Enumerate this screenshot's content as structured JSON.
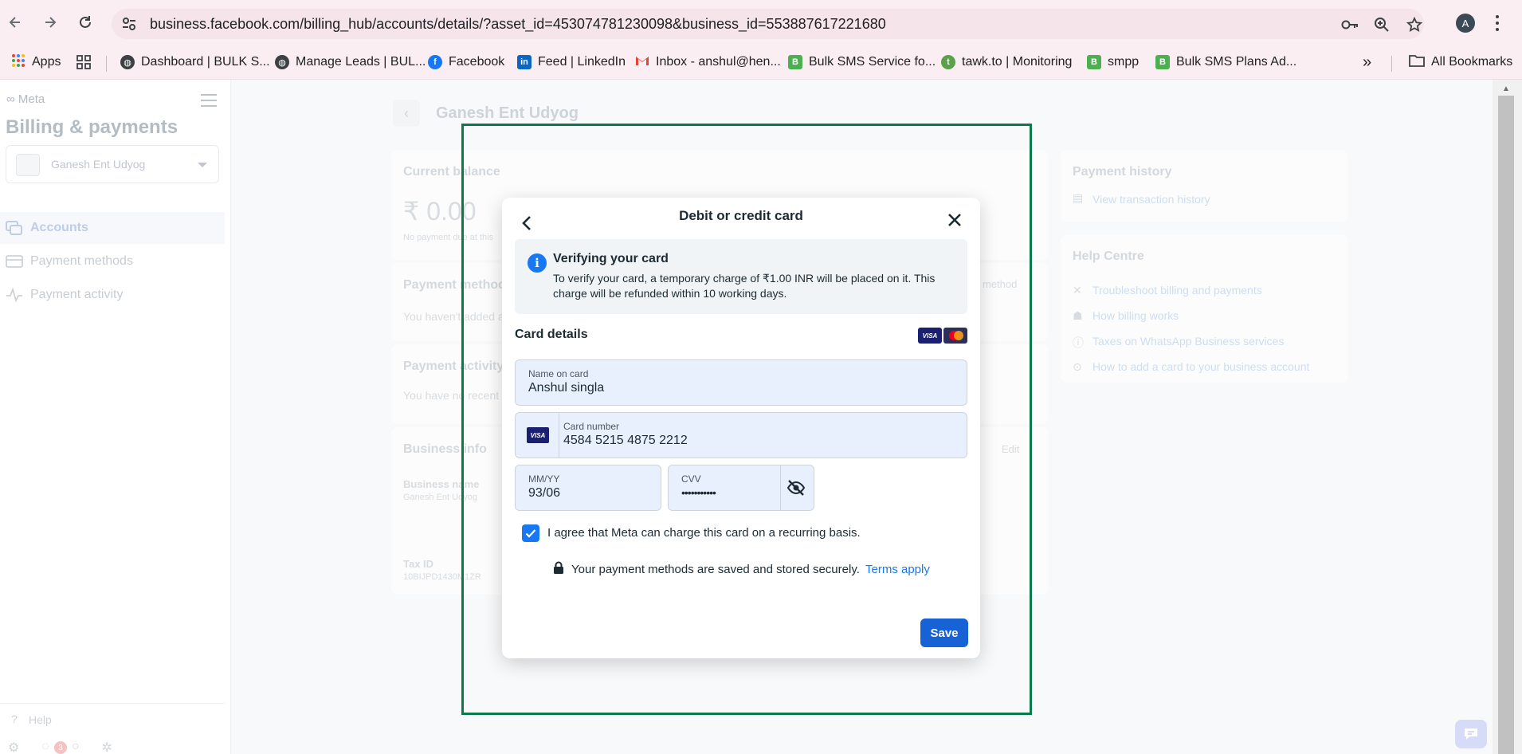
{
  "browser": {
    "url": "business.facebook.com/billing_hub/accounts/details/?asset_id=453074781230098&business_id=553887617221680",
    "profile_initial": "A",
    "bookmarks": [
      {
        "label": "Apps",
        "icon": "apps-grid-icon"
      },
      {
        "label": "Dashboard | BULK S...",
        "icon": "globe-icon"
      },
      {
        "label": "Manage Leads | BUL...",
        "icon": "globe-icon"
      },
      {
        "label": "Facebook",
        "icon": "facebook-icon"
      },
      {
        "label": "Feed | LinkedIn",
        "icon": "linkedin-icon"
      },
      {
        "label": "Inbox - anshul@hen...",
        "icon": "gmail-icon"
      },
      {
        "label": "Bulk SMS Service fo...",
        "icon": "bulksms-icon"
      },
      {
        "label": "tawk.to | Monitoring",
        "icon": "tawk-icon"
      },
      {
        "label": "smpp",
        "icon": "bulksms-icon"
      },
      {
        "label": "Bulk SMS Plans Ad...",
        "icon": "bulksms-icon"
      }
    ],
    "all_bookmarks": "All Bookmarks"
  },
  "sidebar": {
    "logo": "Meta",
    "title": "Billing & payments",
    "business": "Ganesh Ent Udyog",
    "items": [
      {
        "label": "Accounts",
        "active": true
      },
      {
        "label": "Payment methods",
        "active": false
      },
      {
        "label": "Payment activity",
        "active": false
      }
    ],
    "help": "Help",
    "notification_count": "3"
  },
  "main": {
    "title": "Ganesh Ent Udyog",
    "current_balance": {
      "heading": "Current balance",
      "amount": "₹ 0.00",
      "note": "No payment due at this"
    },
    "payment_method": {
      "heading": "Payment method",
      "body": "You haven't added a",
      "action": "method"
    },
    "payment_activity": {
      "heading": "Payment activity",
      "body": "You have no recent"
    },
    "business_info": {
      "heading": "Business info",
      "edit": "Edit",
      "name_label": "Business name",
      "name_value": "Ganesh Ent Udyog",
      "tax_label": "Tax ID",
      "tax_value": "10BIJPD1430M1ZR"
    },
    "payment_history": {
      "heading": "Payment history",
      "link": "View transaction history"
    },
    "help_centre": {
      "heading": "Help Centre",
      "links": [
        "Troubleshoot billing and payments",
        "How billing works",
        "Taxes on WhatsApp Business services",
        "How to add a card to your business account"
      ]
    }
  },
  "modal": {
    "title": "Debit or credit card",
    "notice_title": "Verifying your card",
    "notice_body": "To verify your card, a temporary charge of ₹1.00 INR will be placed on it. This charge will be refunded within 10 working days.",
    "card_details": "Card details",
    "brand_visa": "VISA",
    "name_label": "Name on card",
    "name_value": "Anshul singla",
    "number_label": "Card number",
    "number_value": "4584 5215 4875 2212",
    "expiry_label": "MM/YY",
    "expiry_value": "93/06",
    "cvv_label": "CVV",
    "cvv_value": "•••••••••••",
    "agree_text": "I agree that Meta can charge this card on a recurring basis.",
    "agree_checked": true,
    "secure_text": "Your payment methods are saved and stored securely.",
    "terms_link": "Terms apply",
    "save_label": "Save"
  },
  "colors": {
    "accent": "#1877f2",
    "save_button": "#1763d6",
    "focus_frame": "#0b7a4b"
  }
}
